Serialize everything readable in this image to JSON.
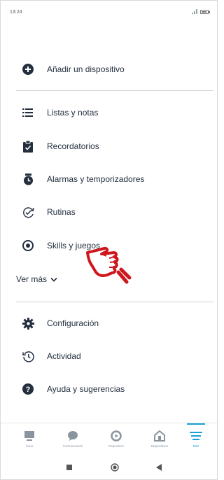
{
  "status_bar": {
    "time": "13:24"
  },
  "menu": {
    "add_device": "Añadir un dispositivo",
    "items": [
      {
        "label": "Listas y notas",
        "icon": "list-icon"
      },
      {
        "label": "Recordatorios",
        "icon": "clipboard-check-icon"
      },
      {
        "label": "Alarmas y temporizadores",
        "icon": "alarm-clock-icon"
      },
      {
        "label": "Rutinas",
        "icon": "routine-check-icon"
      },
      {
        "label": "Skills y juegos",
        "icon": "skills-icon"
      }
    ],
    "ver_mas": "Ver más",
    "settings_items": [
      {
        "label": "Configuración",
        "icon": "gear-icon"
      },
      {
        "label": "Actividad",
        "icon": "history-icon"
      },
      {
        "label": "Ayuda y sugerencias",
        "icon": "help-icon"
      }
    ]
  },
  "bottom_nav": {
    "tabs": [
      {
        "label": "Inicio",
        "icon": "home-icon"
      },
      {
        "label": "Comunicación",
        "icon": "chat-bubble-icon"
      },
      {
        "label": "Reproducir",
        "icon": "play-icon"
      },
      {
        "label": "Dispositivos",
        "icon": "devices-icon"
      },
      {
        "label": "Más",
        "icon": "menu-icon",
        "active": true
      }
    ],
    "accent_color": "#1aa0d8"
  },
  "colors": {
    "text": "#232f3e",
    "annotation_red": "#d0161d"
  }
}
